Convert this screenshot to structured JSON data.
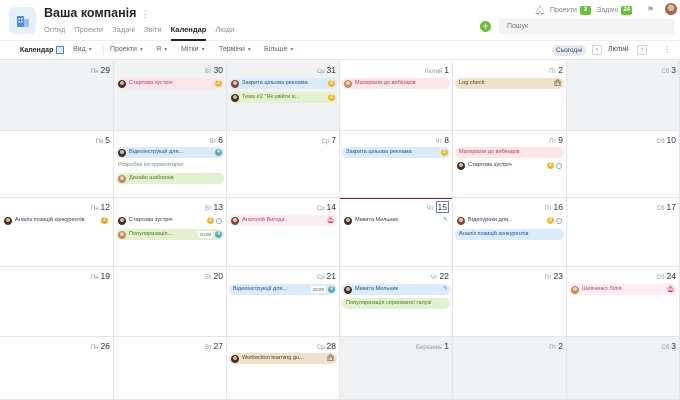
{
  "header": {
    "company": "Ваша компанія",
    "tabs": [
      "Огляд",
      "Проекти",
      "Задачі",
      "Звіти",
      "Календар",
      "Люди"
    ],
    "active_tab": "Календар",
    "projects_label": "Проекти",
    "projects_count": "3",
    "tasks_label": "Задачі",
    "tasks_count": "24",
    "search_placeholder": "Пошук",
    "add_symbol": "+"
  },
  "toolbar": {
    "calendar": "Календар",
    "view": "Вид",
    "projects": "Проекти",
    "me": "Я",
    "tags": "Мітки",
    "deadlines": "Терміни",
    "more": "Більше",
    "today": "Сьогодні",
    "prev": "‹",
    "next": "›",
    "month": "Лютий"
  },
  "weeks": [
    [
      {
        "wd": "Пн",
        "d": "29"
      },
      {
        "wd": "Вт",
        "d": "30"
      },
      {
        "wd": "Ср",
        "d": "31"
      },
      {
        "wd": "Лютий",
        "d": "1"
      },
      {
        "wd": "Пт",
        "d": "2"
      },
      {
        "wd": "Сб",
        "d": "3"
      }
    ],
    [
      {
        "wd": "Пн",
        "d": "5"
      },
      {
        "wd": "Вт",
        "d": "6"
      },
      {
        "wd": "Ср",
        "d": "7"
      },
      {
        "wd": "Чт",
        "d": "8"
      },
      {
        "wd": "Пт",
        "d": "9"
      },
      {
        "wd": "Сб",
        "d": "10"
      }
    ],
    [
      {
        "wd": "Пн",
        "d": "12"
      },
      {
        "wd": "Вт",
        "d": "13"
      },
      {
        "wd": "Ср",
        "d": "14"
      },
      {
        "wd": "Чт",
        "d": "15"
      },
      {
        "wd": "Пт",
        "d": "16"
      },
      {
        "wd": "Сб",
        "d": "17"
      }
    ],
    [
      {
        "wd": "Пн",
        "d": "19"
      },
      {
        "wd": "Вт",
        "d": "20"
      },
      {
        "wd": "Ср",
        "d": "21"
      },
      {
        "wd": "Чт",
        "d": "22"
      },
      {
        "wd": "Пт",
        "d": "23"
      },
      {
        "wd": "Сб",
        "d": "24"
      }
    ],
    [
      {
        "wd": "Пн",
        "d": "26"
      },
      {
        "wd": "Вт",
        "d": "27"
      },
      {
        "wd": "Ср",
        "d": "28"
      },
      {
        "wd": "Березень",
        "d": "1"
      },
      {
        "wd": "Пт",
        "d": "2"
      },
      {
        "wd": "Сб",
        "d": "3"
      }
    ]
  ],
  "events": {
    "w1_tue": "Стартова зустріч",
    "w1_tue_cnt": "2",
    "w1_wed_a": "Закрита цільова реклама",
    "w1_wed_a_cnt": "2",
    "w1_wed_b": "Тема #2 \"Як увійти в...",
    "w1_wed_b_cnt": "2",
    "w1_thu": "Матеріали до вебінарів",
    "w1_fri": "Log check",
    "w2_tue_a": "Відеоінструкції для...",
    "w2_tue_a_cnt": "4",
    "w2_tue_note": "Розробка інструментарію",
    "w2_tue_b": "Дизайн шаблонів",
    "w2_thu": "Закрита цільова реклама",
    "w2_thu_cnt": "2",
    "w2_fri_a": "Матеріали до вебінарів",
    "w2_fri_b": "Стартова зустріч",
    "w2_fri_b_cnt": "2",
    "w3_mon": "Аналіз позицій конкурентів",
    "w3_mon_cnt": "2",
    "w3_tue_a": "Стартова зустріч",
    "w3_tue_a_cnt": "2",
    "w3_tue_b": "Популяризація...",
    "w3_tue_b_time": "10:00",
    "w3_tue_b_cnt": "4",
    "w3_wed": "Анатолій Вигода",
    "w3_thu": "Микита Мельник",
    "w3_fri_a": "Відеоуроки для...",
    "w3_fri_a_cnt": "2",
    "w3_fri_b": "Аналіз позицій конкурентів",
    "w4_wed": "Відеоінструкції для...",
    "w4_wed_time": "15:00",
    "w4_wed_cnt": "4",
    "w4_thu_a": "Микита Мельник",
    "w4_thu_b": "Популяризація сервованої галузі",
    "w4_sat": "Шевченко Лілія",
    "w5_wed": "Workection learning gu..."
  }
}
